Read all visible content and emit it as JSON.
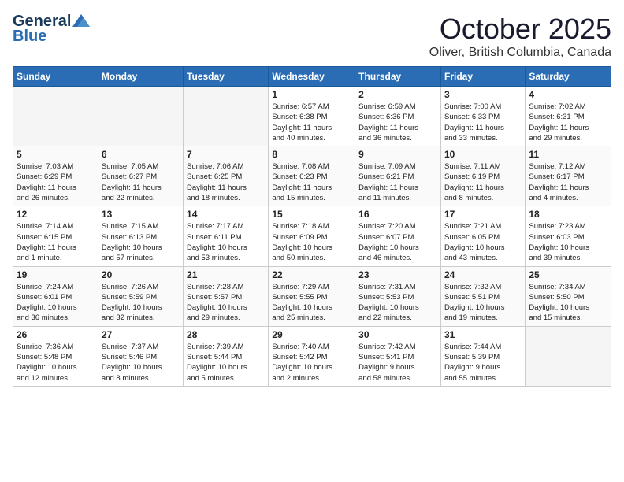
{
  "header": {
    "logo_line1": "General",
    "logo_line2": "Blue",
    "title": "October 2025",
    "subtitle": "Oliver, British Columbia, Canada"
  },
  "weekdays": [
    "Sunday",
    "Monday",
    "Tuesday",
    "Wednesday",
    "Thursday",
    "Friday",
    "Saturday"
  ],
  "weeks": [
    [
      {
        "day": "",
        "info": ""
      },
      {
        "day": "",
        "info": ""
      },
      {
        "day": "",
        "info": ""
      },
      {
        "day": "1",
        "info": "Sunrise: 6:57 AM\nSunset: 6:38 PM\nDaylight: 11 hours\nand 40 minutes."
      },
      {
        "day": "2",
        "info": "Sunrise: 6:59 AM\nSunset: 6:36 PM\nDaylight: 11 hours\nand 36 minutes."
      },
      {
        "day": "3",
        "info": "Sunrise: 7:00 AM\nSunset: 6:33 PM\nDaylight: 11 hours\nand 33 minutes."
      },
      {
        "day": "4",
        "info": "Sunrise: 7:02 AM\nSunset: 6:31 PM\nDaylight: 11 hours\nand 29 minutes."
      }
    ],
    [
      {
        "day": "5",
        "info": "Sunrise: 7:03 AM\nSunset: 6:29 PM\nDaylight: 11 hours\nand 26 minutes."
      },
      {
        "day": "6",
        "info": "Sunrise: 7:05 AM\nSunset: 6:27 PM\nDaylight: 11 hours\nand 22 minutes."
      },
      {
        "day": "7",
        "info": "Sunrise: 7:06 AM\nSunset: 6:25 PM\nDaylight: 11 hours\nand 18 minutes."
      },
      {
        "day": "8",
        "info": "Sunrise: 7:08 AM\nSunset: 6:23 PM\nDaylight: 11 hours\nand 15 minutes."
      },
      {
        "day": "9",
        "info": "Sunrise: 7:09 AM\nSunset: 6:21 PM\nDaylight: 11 hours\nand 11 minutes."
      },
      {
        "day": "10",
        "info": "Sunrise: 7:11 AM\nSunset: 6:19 PM\nDaylight: 11 hours\nand 8 minutes."
      },
      {
        "day": "11",
        "info": "Sunrise: 7:12 AM\nSunset: 6:17 PM\nDaylight: 11 hours\nand 4 minutes."
      }
    ],
    [
      {
        "day": "12",
        "info": "Sunrise: 7:14 AM\nSunset: 6:15 PM\nDaylight: 11 hours\nand 1 minute."
      },
      {
        "day": "13",
        "info": "Sunrise: 7:15 AM\nSunset: 6:13 PM\nDaylight: 10 hours\nand 57 minutes."
      },
      {
        "day": "14",
        "info": "Sunrise: 7:17 AM\nSunset: 6:11 PM\nDaylight: 10 hours\nand 53 minutes."
      },
      {
        "day": "15",
        "info": "Sunrise: 7:18 AM\nSunset: 6:09 PM\nDaylight: 10 hours\nand 50 minutes."
      },
      {
        "day": "16",
        "info": "Sunrise: 7:20 AM\nSunset: 6:07 PM\nDaylight: 10 hours\nand 46 minutes."
      },
      {
        "day": "17",
        "info": "Sunrise: 7:21 AM\nSunset: 6:05 PM\nDaylight: 10 hours\nand 43 minutes."
      },
      {
        "day": "18",
        "info": "Sunrise: 7:23 AM\nSunset: 6:03 PM\nDaylight: 10 hours\nand 39 minutes."
      }
    ],
    [
      {
        "day": "19",
        "info": "Sunrise: 7:24 AM\nSunset: 6:01 PM\nDaylight: 10 hours\nand 36 minutes."
      },
      {
        "day": "20",
        "info": "Sunrise: 7:26 AM\nSunset: 5:59 PM\nDaylight: 10 hours\nand 32 minutes."
      },
      {
        "day": "21",
        "info": "Sunrise: 7:28 AM\nSunset: 5:57 PM\nDaylight: 10 hours\nand 29 minutes."
      },
      {
        "day": "22",
        "info": "Sunrise: 7:29 AM\nSunset: 5:55 PM\nDaylight: 10 hours\nand 25 minutes."
      },
      {
        "day": "23",
        "info": "Sunrise: 7:31 AM\nSunset: 5:53 PM\nDaylight: 10 hours\nand 22 minutes."
      },
      {
        "day": "24",
        "info": "Sunrise: 7:32 AM\nSunset: 5:51 PM\nDaylight: 10 hours\nand 19 minutes."
      },
      {
        "day": "25",
        "info": "Sunrise: 7:34 AM\nSunset: 5:50 PM\nDaylight: 10 hours\nand 15 minutes."
      }
    ],
    [
      {
        "day": "26",
        "info": "Sunrise: 7:36 AM\nSunset: 5:48 PM\nDaylight: 10 hours\nand 12 minutes."
      },
      {
        "day": "27",
        "info": "Sunrise: 7:37 AM\nSunset: 5:46 PM\nDaylight: 10 hours\nand 8 minutes."
      },
      {
        "day": "28",
        "info": "Sunrise: 7:39 AM\nSunset: 5:44 PM\nDaylight: 10 hours\nand 5 minutes."
      },
      {
        "day": "29",
        "info": "Sunrise: 7:40 AM\nSunset: 5:42 PM\nDaylight: 10 hours\nand 2 minutes."
      },
      {
        "day": "30",
        "info": "Sunrise: 7:42 AM\nSunset: 5:41 PM\nDaylight: 9 hours\nand 58 minutes."
      },
      {
        "day": "31",
        "info": "Sunrise: 7:44 AM\nSunset: 5:39 PM\nDaylight: 9 hours\nand 55 minutes."
      },
      {
        "day": "",
        "info": ""
      }
    ]
  ]
}
